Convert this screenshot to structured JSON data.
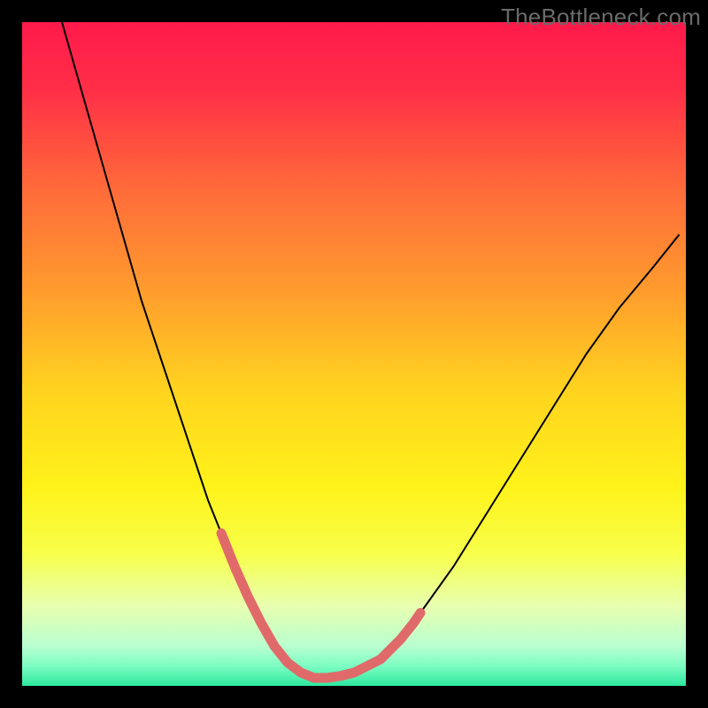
{
  "watermark": "TheBottleneck.com",
  "chart_data": {
    "type": "line",
    "title": "",
    "xlabel": "",
    "ylabel": "",
    "xlim": [
      0,
      100
    ],
    "ylim": [
      0,
      100
    ],
    "gradient_stops": [
      {
        "offset": 0.0,
        "color": "#ff1a4b"
      },
      {
        "offset": 0.1,
        "color": "#ff2e47"
      },
      {
        "offset": 0.25,
        "color": "#ff6a3a"
      },
      {
        "offset": 0.4,
        "color": "#ff9a2e"
      },
      {
        "offset": 0.55,
        "color": "#ffd21f"
      },
      {
        "offset": 0.7,
        "color": "#fff21a"
      },
      {
        "offset": 0.8,
        "color": "#f7ff4a"
      },
      {
        "offset": 0.88,
        "color": "#e8ffb0"
      },
      {
        "offset": 0.94,
        "color": "#b9ffd0"
      },
      {
        "offset": 0.97,
        "color": "#7dfdc2"
      },
      {
        "offset": 1.0,
        "color": "#2de8a0"
      }
    ],
    "series": [
      {
        "name": "bottleneck-curve",
        "color": "#000000",
        "width": 2,
        "x": [
          6,
          8,
          10,
          12,
          14,
          16,
          18,
          20,
          22,
          24,
          26,
          28,
          30,
          32,
          34,
          36,
          38,
          40,
          42,
          44,
          46,
          50,
          55,
          60,
          65,
          70,
          75,
          80,
          85,
          90,
          95,
          99
        ],
        "y": [
          100,
          93,
          86,
          79,
          72,
          65,
          58,
          52,
          46,
          40,
          34,
          28,
          23,
          18,
          13.5,
          9.5,
          6,
          3.5,
          2,
          1.2,
          1.2,
          2,
          5,
          11,
          18,
          26,
          34,
          42,
          50,
          57,
          63,
          68
        ]
      },
      {
        "name": "highlight-left",
        "color": "#e06a6a",
        "width": 11,
        "linecap": "round",
        "x": [
          30,
          32,
          34,
          36,
          38
        ],
        "y": [
          23,
          18,
          13.5,
          9.5,
          6
        ]
      },
      {
        "name": "highlight-bottom",
        "color": "#e06a6a",
        "width": 11,
        "linecap": "round",
        "x": [
          38,
          40,
          42,
          44,
          46,
          48,
          50
        ],
        "y": [
          6,
          3.5,
          2,
          1.2,
          1.2,
          1.5,
          2
        ]
      },
      {
        "name": "highlight-right",
        "color": "#e06a6a",
        "width": 11,
        "linecap": "round",
        "x": [
          50,
          52,
          54,
          55
        ],
        "y": [
          2,
          3,
          4,
          5
        ]
      },
      {
        "name": "highlight-right-upper",
        "color": "#e06a6a",
        "width": 11,
        "linecap": "round",
        "x": [
          55,
          57,
          59,
          60
        ],
        "y": [
          5,
          7,
          9.5,
          11
        ]
      }
    ]
  }
}
